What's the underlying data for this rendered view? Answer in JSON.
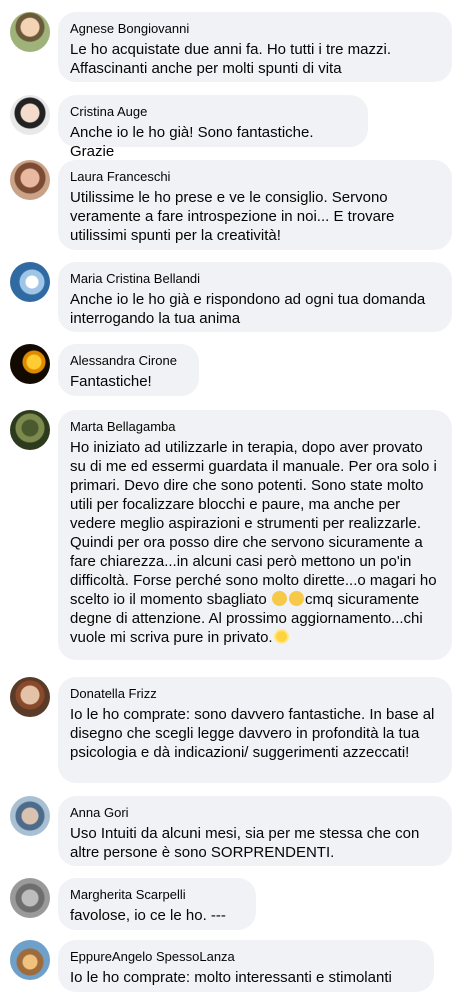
{
  "comments": [
    {
      "name": "Agnese Bongiovanni",
      "text": "Le ho acquistate due anni fa. Ho tutti i tre mazzi. Affascinanti anche per molti spunti di vita"
    },
    {
      "name": "Cristina Auge",
      "text": "Anche io le ho già! Sono fantastiche. Grazie"
    },
    {
      "name": "Laura Franceschi",
      "text": "Utilissime le ho prese e ve le consiglio. Servono veramente a fare introspezione in noi... E trovare utilissimi spunti per la creatività!"
    },
    {
      "name": "Maria Cristina Bellandi",
      "text": "Anche io le ho già e rispondono ad ogni tua domanda interrogando la tua anima"
    },
    {
      "name": "Alessandra Cirone",
      "text": "Fantastiche!"
    },
    {
      "name": "Marta Bellagamba",
      "text": "Ho iniziato ad utilizzarle in terapia, dopo aver provato su di me ed essermi guardata il manuale. Per ora solo i primari. Devo dire che sono potenti. Sono state molto utili per focalizzare blocchi e paure, ma anche per vedere meglio aspirazioni e strumenti per realizzarle. Quindi per ora posso dire che servono sicuramente a fare chiarezza...in alcuni casi però mettono un po'in difficoltà. Forse perché sono molto dirette...o magari ho scelto io il momento sbagliato",
      "text_mid": "cmq sicuramente degne di attenzione. Al prossimo aggiornamento...chi vuole mi scriva pure in privato."
    },
    {
      "name": "Donatella Frizz",
      "text": "Io le ho comprate: sono davvero fantastiche. In base al disegno che scegli legge davvero in profondità la tua psicologia e dà indicazioni/ suggerimenti azzeccati!"
    },
    {
      "name": "Anna Gori",
      "text": "Uso Intuiti da alcuni mesi, sia per me stessa che con altre persone è sono SORPRENDENTI."
    },
    {
      "name": "Margherita Scarpelli",
      "text": "favolose, io ce le ho. ---"
    },
    {
      "name": "EppureAngelo SpessoLanza",
      "text": "Io le ho comprate: molto interessanti e stimolanti"
    }
  ],
  "emojis": [
    "thinking-face-emoji",
    "relieved-face-emoji",
    "sun-emoji"
  ]
}
